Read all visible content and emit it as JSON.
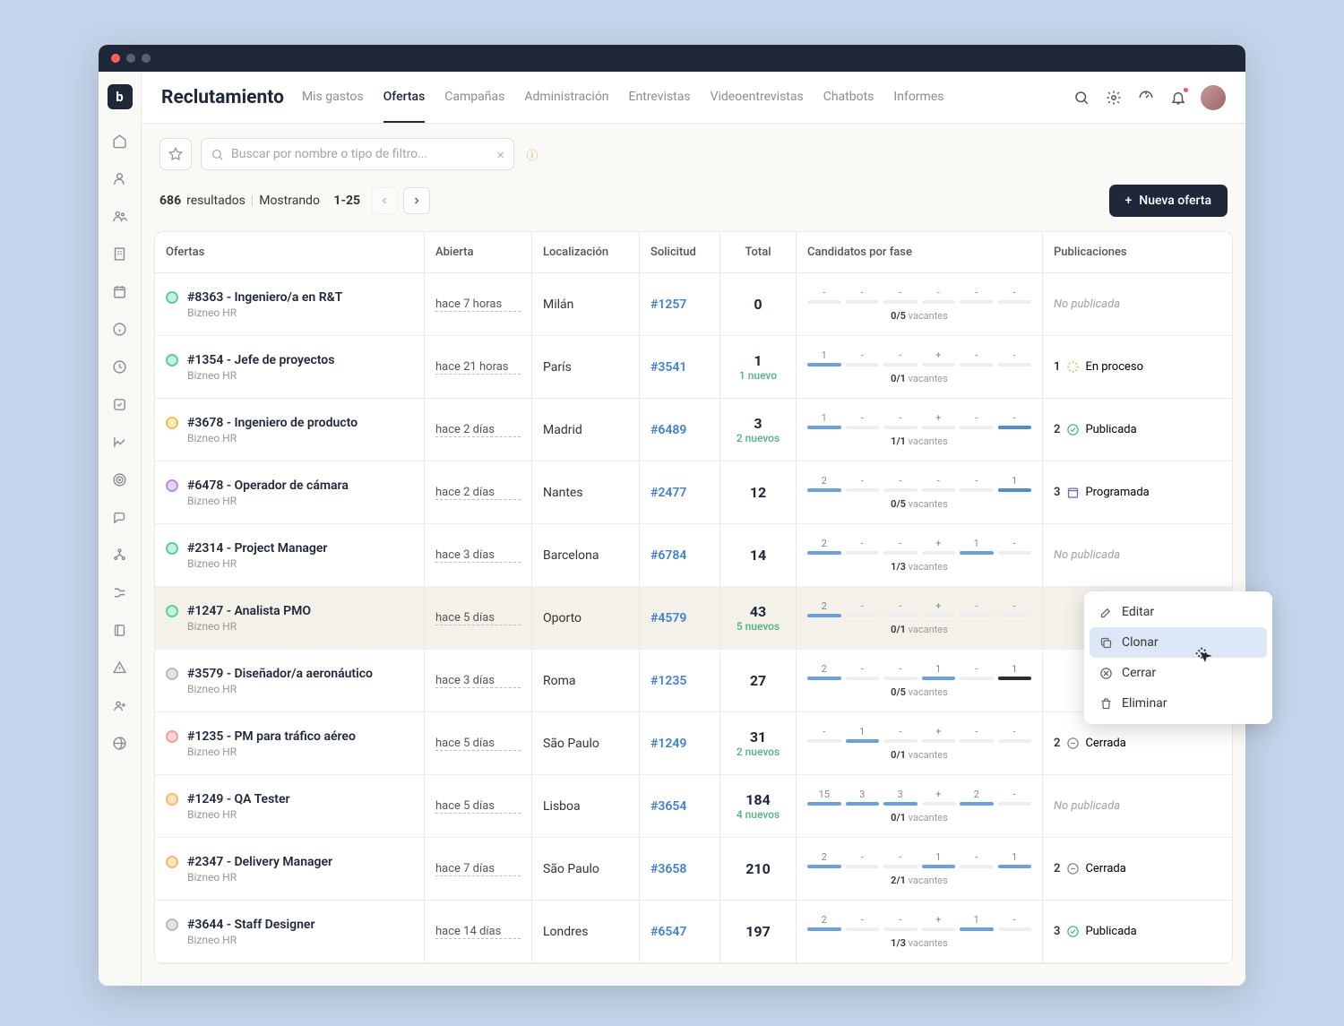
{
  "header": {
    "title": "Reclutamiento"
  },
  "nav": [
    "Mis gastos",
    "Ofertas",
    "Campañas",
    "Administración",
    "Entrevistas",
    "Videoentrevistas",
    "Chatbots",
    "Informes"
  ],
  "activeTab": 1,
  "search": {
    "placeholder": "Buscar por nombre o tipo de filtro..."
  },
  "results": {
    "count": "686",
    "label": "resultados",
    "showing": "Mostrando",
    "range": "1-25"
  },
  "newOffer": "Nueva oferta",
  "columns": [
    "Ofertas",
    "Abierta",
    "Localización",
    "Solicitud",
    "Total",
    "Candidatos por fase",
    "Publicaciones"
  ],
  "contextMenu": [
    "Editar",
    "Clonar",
    "Cerrar",
    "Eliminar"
  ],
  "contextHighlight": 1,
  "vacLabel": "vacantes",
  "rows": [
    {
      "status": "g",
      "title": "#8363 - Ingeniero/a en R&T",
      "company": "Bizneo HR",
      "open": "hace 7 horas",
      "loc": "Milán",
      "req": "#1257",
      "total": "0",
      "new": "",
      "phases": [
        "-",
        "-",
        "-",
        "-",
        "-",
        "-"
      ],
      "bars": [
        0,
        0,
        0,
        0,
        0,
        0
      ],
      "vac": "0/5",
      "pubN": "",
      "pubStatus": "no",
      "pubLabel": "No publicada"
    },
    {
      "status": "g",
      "title": "#1354 - Jefe de proyectos",
      "company": "Bizneo HR",
      "open": "hace 21 horas",
      "loc": "París",
      "req": "#3541",
      "total": "1",
      "new": "1 nuevo",
      "phases": [
        "1",
        "-",
        "-",
        "+",
        "-",
        "-"
      ],
      "bars": [
        1,
        0,
        0,
        0,
        0,
        0
      ],
      "vac": "0/1",
      "pubN": "1",
      "pubStatus": "proc",
      "pubLabel": "En proceso"
    },
    {
      "status": "y",
      "title": "#3678 - Ingeniero de producto",
      "company": "Bizneo HR",
      "open": "hace 2 días",
      "loc": "Madrid",
      "req": "#6489",
      "total": "3",
      "new": "2 nuevos",
      "phases": [
        "1",
        "-",
        "-",
        "+",
        "-",
        "-"
      ],
      "bars": [
        1,
        0,
        0,
        0,
        0,
        3
      ],
      "vac": "1/1",
      "pubN": "2",
      "pubStatus": "ok",
      "pubLabel": "Publicada"
    },
    {
      "status": "p",
      "title": "#6478 - Operador de cámara",
      "company": "Bizneo HR",
      "open": "hace 2 días",
      "loc": "Nantes",
      "req": "#2477",
      "total": "12",
      "new": "",
      "phases": [
        "2",
        "-",
        "-",
        "-",
        "-",
        "1"
      ],
      "bars": [
        1,
        0,
        0,
        0,
        0,
        3
      ],
      "vac": "0/5",
      "pubN": "3",
      "pubStatus": "cal",
      "pubLabel": "Programada"
    },
    {
      "status": "g",
      "title": "#2314 - Project Manager",
      "company": "Bizneo HR",
      "open": "hace 3 días",
      "loc": "Barcelona",
      "req": "#6784",
      "total": "14",
      "new": "",
      "phases": [
        "2",
        "-",
        "-",
        "+",
        "1",
        "-"
      ],
      "bars": [
        1,
        0,
        0,
        0,
        1,
        0
      ],
      "vac": "1/3",
      "pubN": "",
      "pubStatus": "no",
      "pubLabel": "No publicada"
    },
    {
      "status": "g",
      "title": "#1247 - Analista PMO",
      "company": "Bizneo HR",
      "open": "hace 5 días",
      "loc": "Oporto",
      "req": "#4579",
      "total": "43",
      "new": "5 nuevos",
      "phases": [
        "2",
        "-",
        "-",
        "+",
        "-",
        "-"
      ],
      "bars": [
        1,
        0,
        0,
        0,
        0,
        0
      ],
      "vac": "0/1",
      "pubN": "",
      "pubStatus": "",
      "pubLabel": ""
    },
    {
      "status": "gr",
      "title": "#3579 - Diseñador/a aeronáutico",
      "company": "Bizneo HR",
      "open": "hace 3 días",
      "loc": "Roma",
      "req": "#1235",
      "total": "27",
      "new": "",
      "phases": [
        "2",
        "-",
        "-",
        "1",
        "-",
        "1"
      ],
      "bars": [
        1,
        0,
        0,
        1,
        0,
        4
      ],
      "vac": "0/5",
      "pubN": "",
      "pubStatus": "",
      "pubLabel": ""
    },
    {
      "status": "pk",
      "title": "#1235 - PM para tráfico aéreo",
      "company": "Bizneo HR",
      "open": "hace 5 días",
      "loc": "São Paulo",
      "req": "#1249",
      "total": "31",
      "new": "2 nuevos",
      "phases": [
        "-",
        "1",
        "-",
        "+",
        "-",
        "-"
      ],
      "bars": [
        0,
        1,
        0,
        0,
        0,
        0
      ],
      "vac": "0/1",
      "pubN": "2",
      "pubStatus": "closed",
      "pubLabel": "Cerrada"
    },
    {
      "status": "o",
      "title": "#1249 - QA Tester",
      "company": "Bizneo HR",
      "open": "hace 5 días",
      "loc": "Lisboa",
      "req": "#3654",
      "total": "184",
      "new": "4 nuevos",
      "phases": [
        "15",
        "3",
        "3",
        "+",
        "2",
        "-"
      ],
      "bars": [
        1,
        1,
        1,
        0,
        1,
        0
      ],
      "vac": "0/1",
      "pubN": "",
      "pubStatus": "no",
      "pubLabel": "No publicada"
    },
    {
      "status": "o",
      "title": "#2347 - Delivery Manager",
      "company": "Bizneo HR",
      "open": "hace 7 días",
      "loc": "São Paulo",
      "req": "#3658",
      "total": "210",
      "new": "",
      "phases": [
        "2",
        "-",
        "-",
        "1",
        "-",
        "1"
      ],
      "bars": [
        1,
        0,
        0,
        1,
        0,
        1
      ],
      "vac": "2/1",
      "pubN": "2",
      "pubStatus": "closed",
      "pubLabel": "Cerrada"
    },
    {
      "status": "gr",
      "title": "#3644 - Staff Designer",
      "company": "Bizneo HR",
      "open": "hace 14 días",
      "loc": "Londres",
      "req": "#6547",
      "total": "197",
      "new": "",
      "phases": [
        "2",
        "-",
        "-",
        "+",
        "1",
        "-"
      ],
      "bars": [
        1,
        0,
        0,
        0,
        1,
        0
      ],
      "vac": "1/3",
      "pubN": "3",
      "pubStatus": "ok",
      "pubLabel": "Publicada"
    }
  ]
}
